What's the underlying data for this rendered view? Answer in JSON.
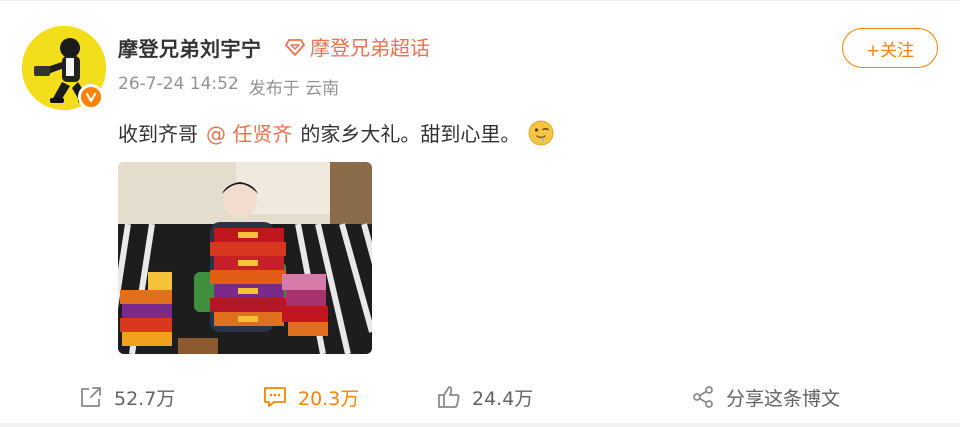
{
  "user": {
    "name": "摩登兄弟刘宇宁",
    "supertopic": "摩登兄弟超话",
    "timestamp": "26-7-24 14:52",
    "source": "发布于 云南"
  },
  "follow_label": "+关注",
  "post": {
    "text_before": "收到齐哥",
    "mention": "@ 任贤齐",
    "text_after": "的家乡大礼。甜到心里。",
    "emoji": "drooling-face-icon"
  },
  "actions": {
    "repost_count": "52.7万",
    "comment_count": "20.3万",
    "like_count": "24.4万",
    "share_label": "分享这条博文"
  },
  "colors": {
    "accent": "#ff8200",
    "link": "#eb7350",
    "muted": "#939393"
  }
}
